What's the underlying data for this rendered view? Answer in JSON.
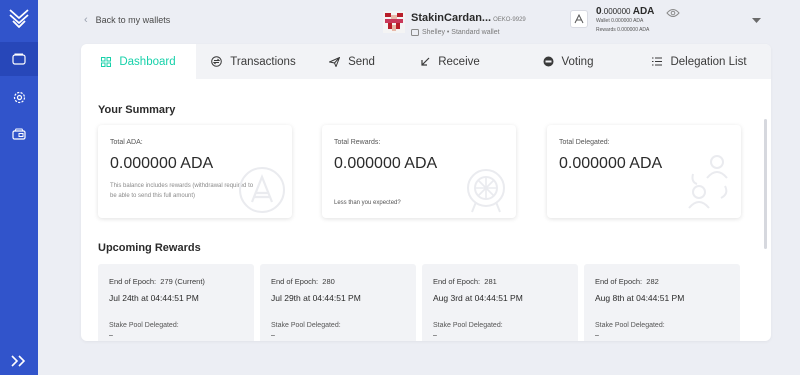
{
  "sidebar": {
    "items": [
      {
        "icon": "wallets-icon"
      },
      {
        "icon": "settings-icon"
      },
      {
        "icon": "staking-icon"
      }
    ],
    "expand_icon": "expand-chevrons-icon"
  },
  "header": {
    "back_label": "Back to my wallets",
    "wallet_name": "StakinCardan...",
    "wallet_id": "OEKO-9929",
    "wallet_type": "Shelley • Standard wallet",
    "balance_main_int": "0",
    "balance_main_dec": ".000000",
    "balance_unit": "ADA",
    "wallet_balance_label": "Wallet",
    "wallet_balance_value": "0.000000 ADA",
    "rewards_balance_label": "Rewards",
    "rewards_balance_value": "0.000000 ADA"
  },
  "tabs": [
    {
      "label": "Dashboard",
      "active": true
    },
    {
      "label": "Transactions"
    },
    {
      "label": "Send"
    },
    {
      "label": "Receive"
    },
    {
      "label": "Voting"
    },
    {
      "label": "Delegation List"
    }
  ],
  "summary": {
    "title": "Your Summary",
    "cards": [
      {
        "label": "Total ADA:",
        "int": "0",
        "dec": ".000000 ADA",
        "note": "This balance includes rewards (withdrawal required to be able to send this full amount)"
      },
      {
        "label": "Total Rewards:",
        "int": "0",
        "dec": ".000000 ADA",
        "link": "Less than you expected?"
      },
      {
        "label": "Total Delegated:",
        "int": "0",
        "dec": ".000000 ADA"
      }
    ]
  },
  "upcoming": {
    "title": "Upcoming Rewards",
    "epoch_prefix": "End of Epoch:",
    "pool_label": "Stake Pool Delegated:",
    "items": [
      {
        "epoch": "279 (Current)",
        "date": "Jul 24th at 04:44:51 PM",
        "pool": "–"
      },
      {
        "epoch": "280",
        "date": "Jul 29th at 04:44:51 PM",
        "pool": "–"
      },
      {
        "epoch": "281",
        "date": "Aug 3rd at 04:44:51 PM",
        "pool": "–"
      },
      {
        "epoch": "282",
        "date": "Aug 8th at 04:44:51 PM",
        "pool": "–"
      }
    ]
  },
  "colors": {
    "sidebar": "#3154cb",
    "accent": "#17d1aa",
    "background": "#eceef4"
  }
}
